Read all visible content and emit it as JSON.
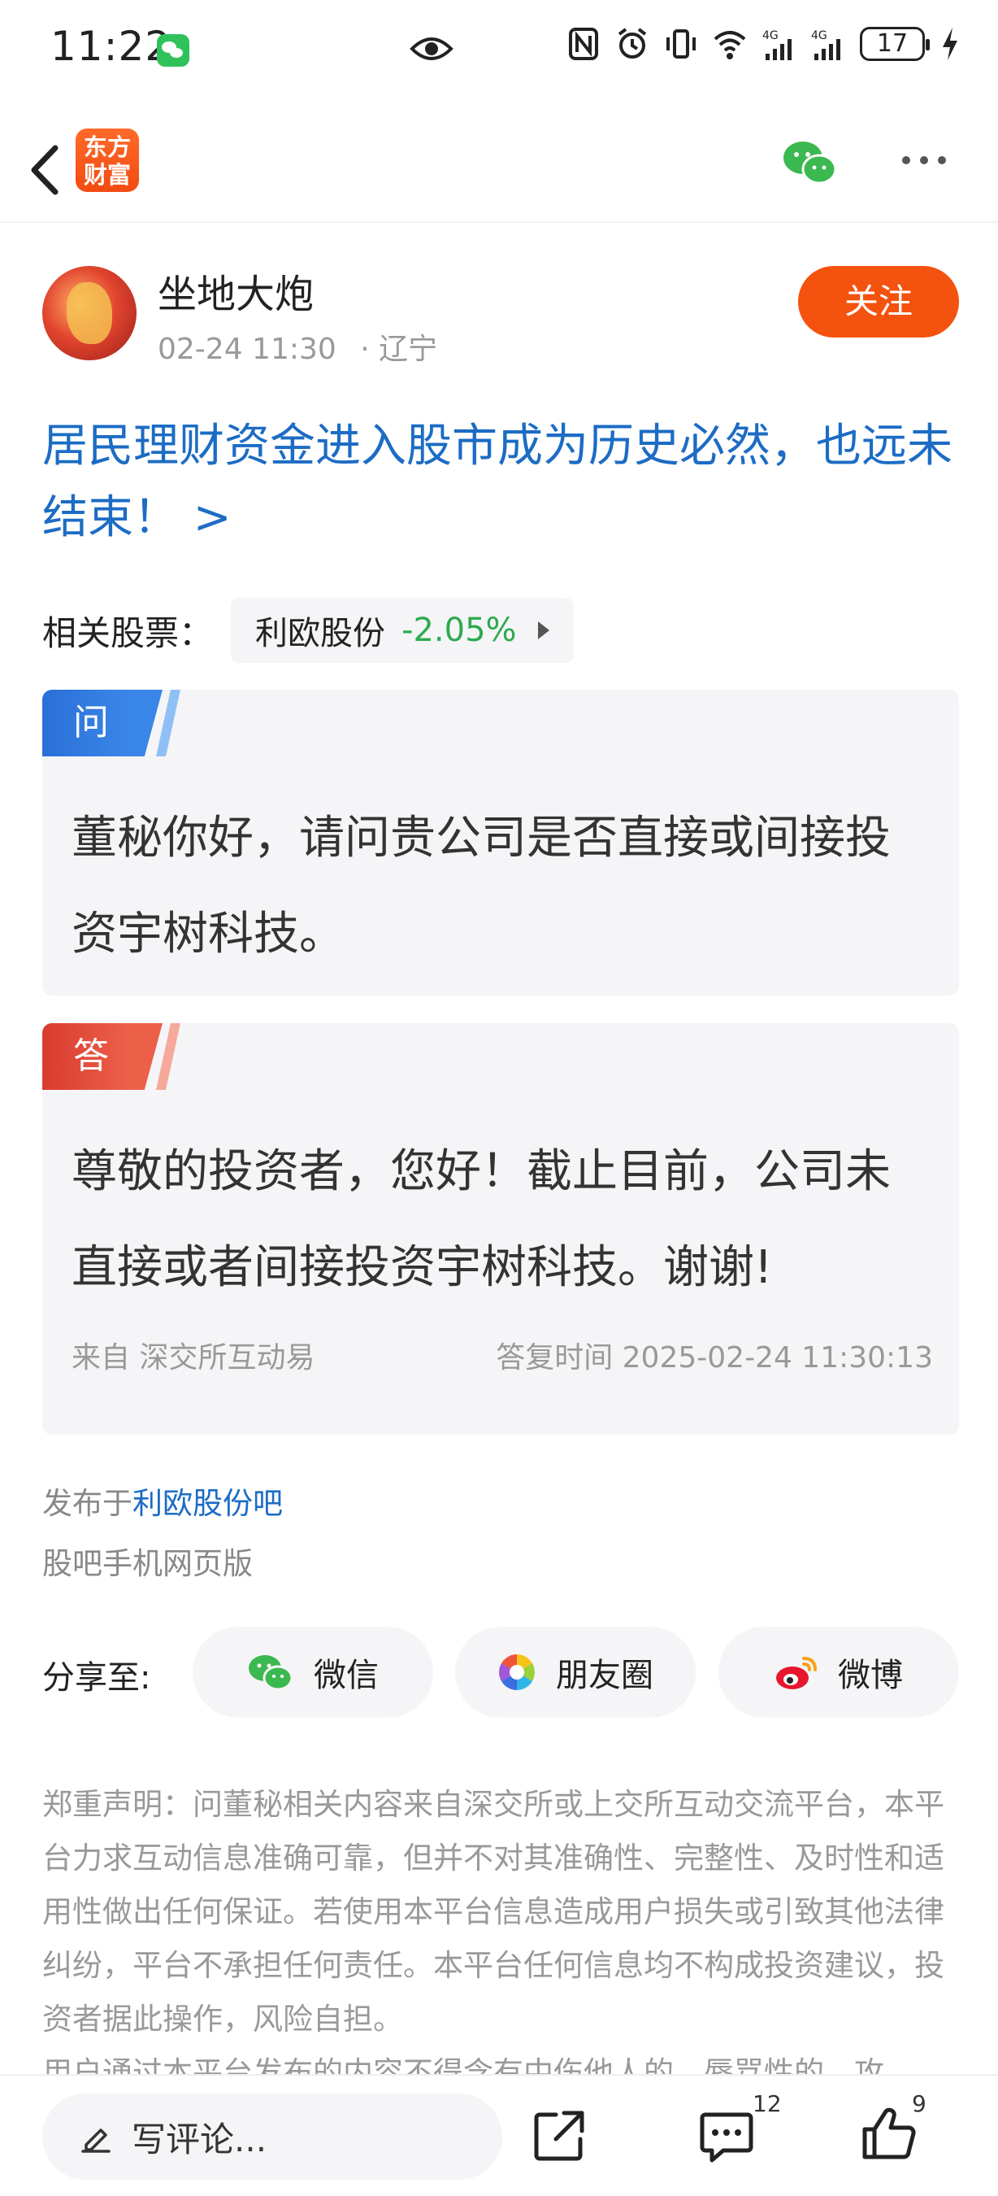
{
  "status_bar": {
    "time": "11:22",
    "battery": "17"
  },
  "header": {
    "logo_text": "东方财富"
  },
  "author": {
    "name": "坐地大炮",
    "datetime": "02-24 11:30",
    "location": "· 辽宁",
    "follow_label": "关注"
  },
  "post": {
    "title": "居民理财资金进入股市成为历史必然，也远未结束！ >"
  },
  "related": {
    "label": "相关股票：",
    "stock_name": "利欧股份",
    "stock_change": "-2.05%"
  },
  "question": {
    "tag": "问",
    "text": "董秘你好，请问贵公司是否直接或间接投资宇树科技。"
  },
  "answer": {
    "tag": "答",
    "text": "尊敬的投资者，您好！截止目前，公司未直接或者间接投资宇树科技。谢谢!",
    "source": "来自 深交所互动易",
    "reply_time": "答复时间 2025-02-24 11:30:13"
  },
  "published": {
    "prefix": "发布于",
    "forum": "利欧股份吧",
    "web_version": "股吧手机网页版"
  },
  "share": {
    "label": "分享至:",
    "wechat": "微信",
    "moments": "朋友圈",
    "weibo": "微博"
  },
  "disclaimer": {
    "text": "郑重声明：问董秘相关内容来自深交所或上交所互动交流平台，本平台力求互动信息准确可靠，但并不对其准确性、完整性、及时性和适用性做出任何保证。若使用本平台信息造成用户损失或引致其他法律纠纷，平台不承担任何责任。本平台任何信息均不构成投资建议，投资者据此操作，风险自担。",
    "text_cut": "用户通过本平台发布的内容不得含有中伤他人的、辱骂性的、攻"
  },
  "bottom_bar": {
    "comment_placeholder": "写评论...",
    "comment_count": "12",
    "like_count": "9"
  },
  "colors": {
    "accent": "#f4520f",
    "link": "#1c6cc4",
    "stock_down": "#2daa4f"
  }
}
